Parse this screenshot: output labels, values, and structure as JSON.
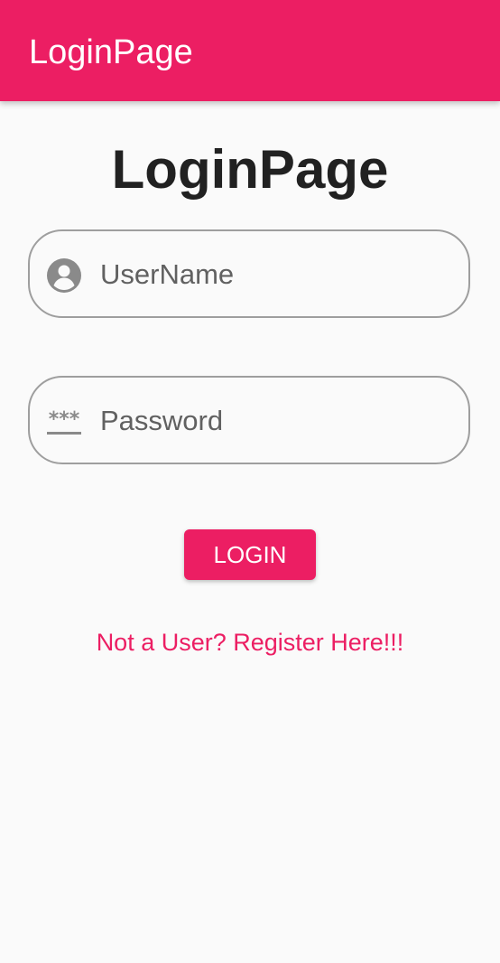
{
  "app_bar": {
    "title": "LoginPage",
    "background_color": "#ec1e63"
  },
  "main": {
    "title": "LoginPage"
  },
  "form": {
    "username": {
      "placeholder": "UserName",
      "value": "",
      "icon": "account-circle-icon"
    },
    "password": {
      "placeholder": "Password",
      "value": "",
      "icon": "password-icon"
    },
    "login_button_label": "LOGIN",
    "register_link_label": "Not a User? Register Here!!!"
  },
  "colors": {
    "accent": "#ec1e63",
    "field_border": "#9e9e9e",
    "icon": "#8a8a8a",
    "text_dark": "#212121"
  }
}
